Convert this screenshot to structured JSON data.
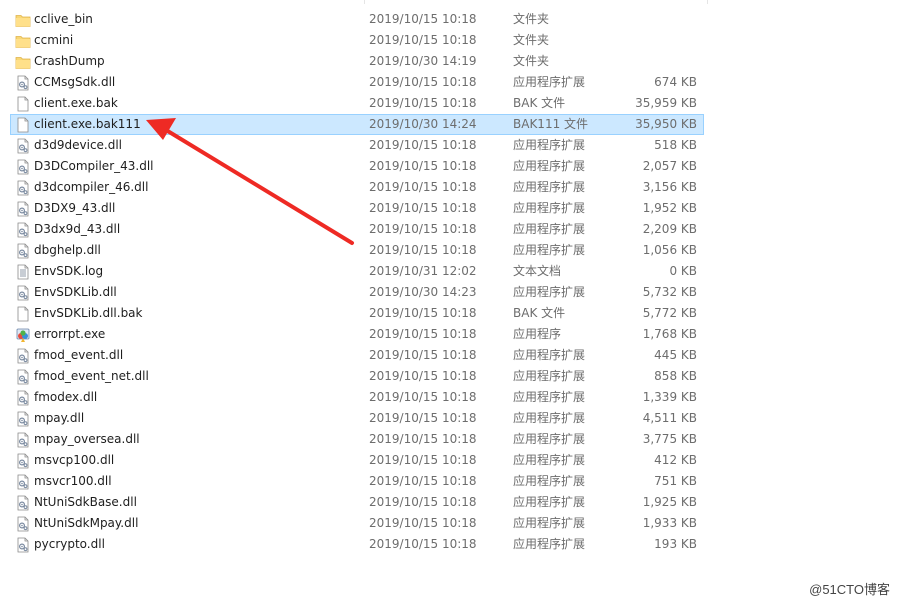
{
  "files": [
    {
      "name": "cclive_bin",
      "date": "2019/10/15 10:18",
      "type": "文件夹",
      "size": "",
      "icon": "folder-icon"
    },
    {
      "name": "ccmini",
      "date": "2019/10/15 10:18",
      "type": "文件夹",
      "size": "",
      "icon": "folder-icon"
    },
    {
      "name": "CrashDump",
      "date": "2019/10/30 14:19",
      "type": "文件夹",
      "size": "",
      "icon": "folder-icon"
    },
    {
      "name": "CCMsgSdk.dll",
      "date": "2019/10/15 10:18",
      "type": "应用程序扩展",
      "size": "674 KB",
      "icon": "dll-file-icon"
    },
    {
      "name": "client.exe.bak",
      "date": "2019/10/15 10:18",
      "type": "BAK 文件",
      "size": "35,959 KB",
      "icon": "blank-file-icon"
    },
    {
      "name": "client.exe.bak111",
      "date": "2019/10/30 14:24",
      "type": "BAK111 文件",
      "size": "35,950 KB",
      "icon": "blank-file-icon",
      "selected": true
    },
    {
      "name": "d3d9device.dll",
      "date": "2019/10/15 10:18",
      "type": "应用程序扩展",
      "size": "518 KB",
      "icon": "dll-file-icon"
    },
    {
      "name": "D3DCompiler_43.dll",
      "date": "2019/10/15 10:18",
      "type": "应用程序扩展",
      "size": "2,057 KB",
      "icon": "dll-file-icon"
    },
    {
      "name": "d3dcompiler_46.dll",
      "date": "2019/10/15 10:18",
      "type": "应用程序扩展",
      "size": "3,156 KB",
      "icon": "dll-file-icon"
    },
    {
      "name": "D3DX9_43.dll",
      "date": "2019/10/15 10:18",
      "type": "应用程序扩展",
      "size": "1,952 KB",
      "icon": "dll-file-icon"
    },
    {
      "name": "D3dx9d_43.dll",
      "date": "2019/10/15 10:18",
      "type": "应用程序扩展",
      "size": "2,209 KB",
      "icon": "dll-file-icon"
    },
    {
      "name": "dbghelp.dll",
      "date": "2019/10/15 10:18",
      "type": "应用程序扩展",
      "size": "1,056 KB",
      "icon": "dll-file-icon"
    },
    {
      "name": "EnvSDK.log",
      "date": "2019/10/31 12:02",
      "type": "文本文档",
      "size": "0 KB",
      "icon": "text-file-icon"
    },
    {
      "name": "EnvSDKLib.dll",
      "date": "2019/10/30 14:23",
      "type": "应用程序扩展",
      "size": "5,732 KB",
      "icon": "dll-file-icon"
    },
    {
      "name": "EnvSDKLib.dll.bak",
      "date": "2019/10/15 10:18",
      "type": "BAK 文件",
      "size": "5,772 KB",
      "icon": "blank-file-icon"
    },
    {
      "name": "errorrpt.exe",
      "date": "2019/10/15 10:18",
      "type": "应用程序",
      "size": "1,768 KB",
      "icon": "exe-file-icon"
    },
    {
      "name": "fmod_event.dll",
      "date": "2019/10/15 10:18",
      "type": "应用程序扩展",
      "size": "445 KB",
      "icon": "dll-file-icon"
    },
    {
      "name": "fmod_event_net.dll",
      "date": "2019/10/15 10:18",
      "type": "应用程序扩展",
      "size": "858 KB",
      "icon": "dll-file-icon"
    },
    {
      "name": "fmodex.dll",
      "date": "2019/10/15 10:18",
      "type": "应用程序扩展",
      "size": "1,339 KB",
      "icon": "dll-file-icon"
    },
    {
      "name": "mpay.dll",
      "date": "2019/10/15 10:18",
      "type": "应用程序扩展",
      "size": "4,511 KB",
      "icon": "dll-file-icon"
    },
    {
      "name": "mpay_oversea.dll",
      "date": "2019/10/15 10:18",
      "type": "应用程序扩展",
      "size": "3,775 KB",
      "icon": "dll-file-icon"
    },
    {
      "name": "msvcp100.dll",
      "date": "2019/10/15 10:18",
      "type": "应用程序扩展",
      "size": "412 KB",
      "icon": "dll-file-icon"
    },
    {
      "name": "msvcr100.dll",
      "date": "2019/10/15 10:18",
      "type": "应用程序扩展",
      "size": "751 KB",
      "icon": "dll-file-icon"
    },
    {
      "name": "NtUniSdkBase.dll",
      "date": "2019/10/15 10:18",
      "type": "应用程序扩展",
      "size": "1,925 KB",
      "icon": "dll-file-icon"
    },
    {
      "name": "NtUniSdkMpay.dll",
      "date": "2019/10/15 10:18",
      "type": "应用程序扩展",
      "size": "1,933 KB",
      "icon": "dll-file-icon"
    },
    {
      "name": "pycrypto.dll",
      "date": "2019/10/15 10:18",
      "type": "应用程序扩展",
      "size": "193 KB",
      "icon": "dll-file-icon"
    }
  ],
  "colors": {
    "selection_bg": "#cce8ff",
    "selection_border": "#99d1ff",
    "arrow": "#ee2a24",
    "folder": "#f8d775"
  },
  "watermark": "@51CTO博客"
}
